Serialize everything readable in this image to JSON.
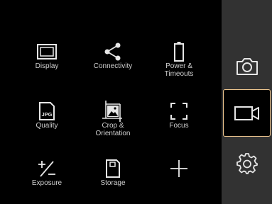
{
  "menu": {
    "tiles": [
      {
        "label": "Display",
        "icon": "display-icon"
      },
      {
        "label": "Connectivity",
        "icon": "share-icon"
      },
      {
        "label": "Power &\nTimeouts",
        "icon": "battery-icon"
      },
      {
        "label": "Quality",
        "icon": "jpg-file-icon",
        "icon_text": "JPG"
      },
      {
        "label": "Crop &\nOrientation",
        "icon": "crop-icon"
      },
      {
        "label": "Focus",
        "icon": "focus-frame-icon"
      },
      {
        "label": "Exposure",
        "icon": "exposure-icon"
      },
      {
        "label": "Storage",
        "icon": "sd-card-icon"
      },
      {
        "label": "",
        "icon": "plus-icon"
      }
    ]
  },
  "sidebar": {
    "modes": [
      {
        "name": "photo",
        "icon": "camera-icon"
      },
      {
        "name": "video",
        "icon": "video-camera-icon",
        "selected": true
      },
      {
        "name": "settings",
        "icon": "gear-icon"
      }
    ]
  },
  "colors": {
    "background": "#000000",
    "sidebar": "#323232",
    "selection": "#f0c890",
    "icon": "#e6e6e6",
    "label": "#d0d0d0"
  }
}
